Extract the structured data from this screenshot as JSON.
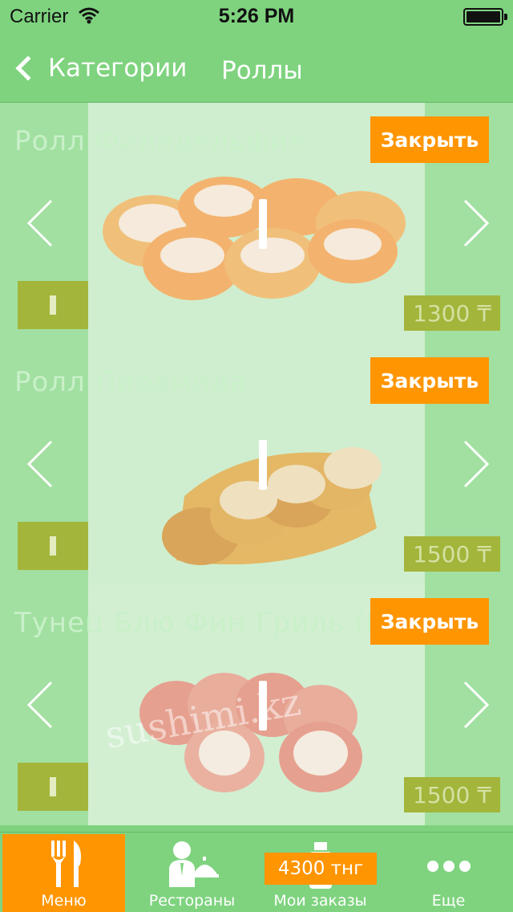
{
  "status": {
    "carrier": "Carrier",
    "time": "5:26 PM"
  },
  "nav": {
    "back_label": "Категории",
    "title": "Роллы"
  },
  "items": [
    {
      "title": "Ролл Филадельфия",
      "close_label": "Закрыть",
      "price": "1300 ₸"
    },
    {
      "title": "Ролл Пирамида",
      "close_label": "Закрыть",
      "price": "1500 ₸"
    },
    {
      "title": "Тунец Блю Фин Гриль (Ма",
      "close_label": "Закрыть",
      "price": "1500 ₸",
      "watermark": "sushimi.kz"
    }
  ],
  "tabs": [
    {
      "label": "Меню",
      "icon": "fork-knife-icon",
      "active": true
    },
    {
      "label": "Рестораны",
      "icon": "waiter-icon",
      "active": false
    },
    {
      "label": "Мои заказы",
      "icon": "bottle-icon",
      "badge": "4300 тнг",
      "active": false
    },
    {
      "label": "Еще",
      "icon": "more-dots-icon",
      "active": false
    }
  ],
  "colors": {
    "bar": "#7fd37f",
    "accent": "#ff9500",
    "card": "#a1e0a1",
    "price_bg": "#a3b53a"
  }
}
